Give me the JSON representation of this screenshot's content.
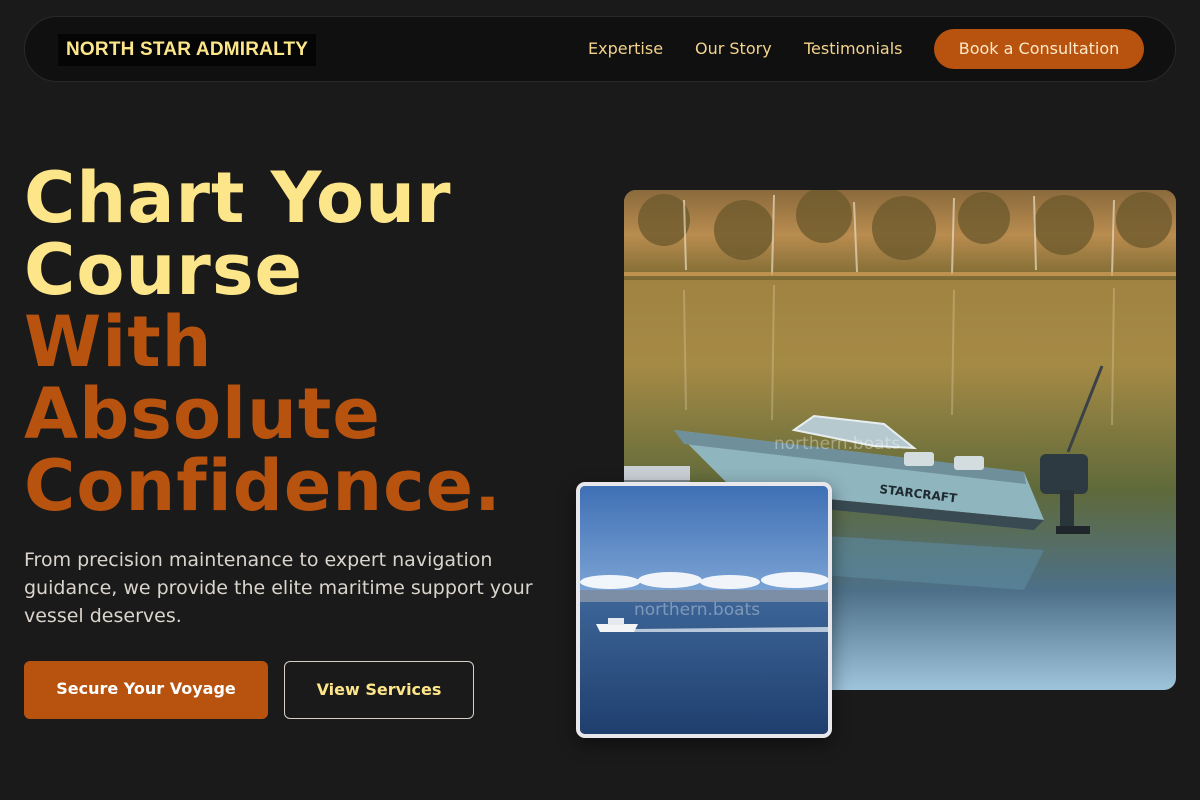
{
  "nav": {
    "brand": "NORTH STAR ADMIRALTY",
    "links": [
      "Expertise",
      "Our Story",
      "Testimonials"
    ],
    "cta": "Book a Consultation"
  },
  "hero": {
    "headline_highlight": [
      "Chart Your",
      "Course"
    ],
    "headline_accent": [
      "With",
      "Absolute",
      "Confidence."
    ],
    "subtitle": "From precision maintenance to expert navigation guidance, we provide the elite maritime support your vessel deserves.",
    "primary_button": "Secure Your Voyage",
    "secondary_button": "View Services"
  },
  "images": {
    "main_alt": "Starcraft fishing boat on a calm lake reflecting autumn trees",
    "main_watermark": "northern.boats",
    "inset_alt": "Motor boat cruising on open blue water",
    "inset_watermark": "northern.boats",
    "boat_hull_text": "STARCRAFT"
  },
  "colors": {
    "background": "#1b1a1a",
    "accent_yellow": "#fde68a",
    "accent_orange": "#b8530f"
  }
}
